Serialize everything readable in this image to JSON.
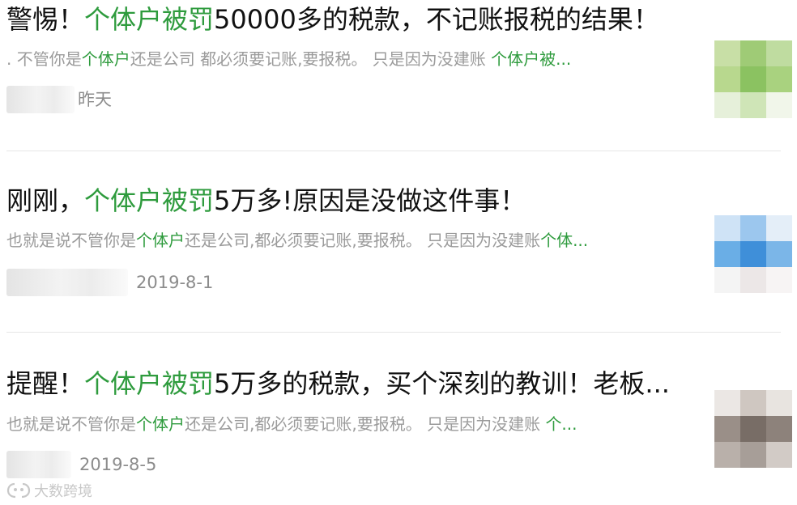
{
  "results": [
    {
      "title_pre": "警惕！",
      "title_hl": "个体户被罚",
      "title_post": "50000多的税款，不记账报税的结果！",
      "snippet_pre": ". 不管你是",
      "snippet_hl1": "个体户",
      "snippet_mid": "还是公司 都必须要记账,要报税。  只是因为没建账 ",
      "snippet_hl2": "个体户被...",
      "date": "昨天",
      "thumb_colors": [
        "#c8dfa6",
        "#9fcb76",
        "#bfdca0",
        "#b8d88e",
        "#8bc261",
        "#a9d27f",
        "#e6f0da",
        "#cfe5b7",
        "#f1f6ea"
      ]
    },
    {
      "title_pre": "刚刚，",
      "title_hl": "个体户被罚",
      "title_post": "5万多!原因是没做这件事！",
      "snippet_pre": "也就是说不管你是",
      "snippet_hl1": "个体户",
      "snippet_mid": "还是公司,都必须要记账,要报税。  只是因为没建账",
      "snippet_hl2": "个体...",
      "date": "2019-8-1",
      "thumb_colors": [
        "#cfe3f6",
        "#9cc7ee",
        "#e4eef8",
        "#6aaee6",
        "#3f8fd9",
        "#7bb6e8",
        "#f4f4f4",
        "#ece7e7",
        "#f7f4f4"
      ]
    },
    {
      "title_pre": "提醒！",
      "title_hl": "个体户被罚",
      "title_post": "5万多的税款，买个深刻的教训！老板...",
      "snippet_pre": "也就是说不管你是",
      "snippet_hl1": "个体户",
      "snippet_mid": "还是公司,都必须要记账,要报税。  只是因为没建账 ",
      "snippet_hl2": "个...",
      "date": "2019-8-5",
      "thumb_colors": [
        "#ebe7e4",
        "#cfc7c1",
        "#e8e4e0",
        "#9a8f88",
        "#786d66",
        "#8d827b",
        "#b9b0aa",
        "#a79e98",
        "#d2cbc6"
      ]
    }
  ],
  "watermark": {
    "text": "大数跨境"
  }
}
